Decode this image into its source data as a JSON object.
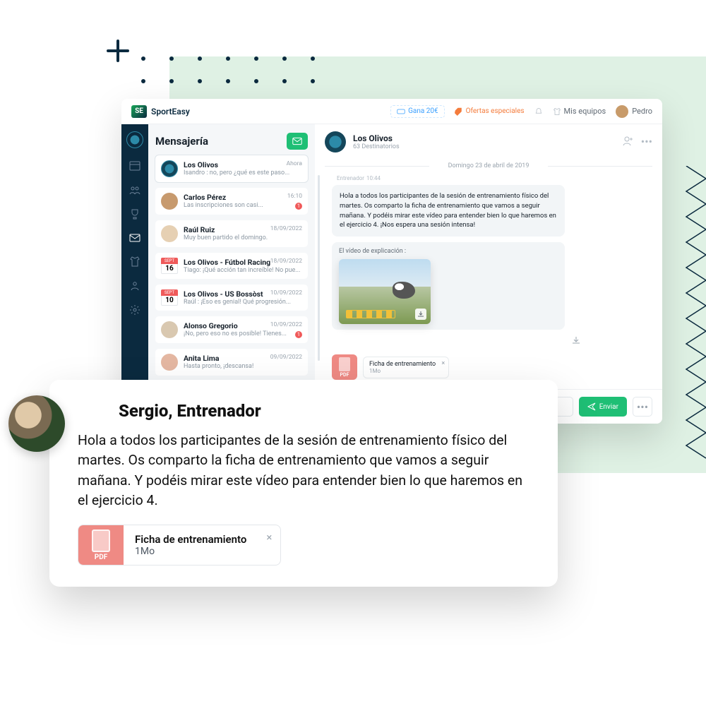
{
  "brand": "SportEasy",
  "topbar": {
    "earn": "Gana 20€",
    "offers": "Ofertas especiales",
    "teams": "Mis equipos",
    "user": "Pedro"
  },
  "sidebar_title": "Mensajería",
  "conversations": [
    {
      "name": "Los Olivos",
      "preview": "Isandro : no, pero ¿qué es este paso...",
      "time": "Ahora"
    },
    {
      "name": "Carlos Pérez",
      "preview": "Las inscripciones son casi...",
      "time": "16:10",
      "badge": "1"
    },
    {
      "name": "Raúl Ruiz",
      "preview": "Muy buen partido el domingo.",
      "time": "18/09/2022"
    },
    {
      "name": "Los Olivos - Fútbol Racing",
      "preview": "Tiago: ¡Qué acción tan increíble! No pue...",
      "time": "18/09/2022",
      "month": "SEPT",
      "day": "16"
    },
    {
      "name": "Los Olivos - US Bossòst",
      "preview": "Raúl : ¡Eso es genial! Qué progresión...",
      "time": "10/09/2022",
      "month": "SEPT",
      "day": "10"
    },
    {
      "name": "Alonso Gregorio",
      "preview": "¡No, pero eso no es posible! Tienes...",
      "time": "10/09/2022",
      "badge": "1"
    },
    {
      "name": "Anita Lima",
      "preview": "Hasta pronto, ¡descansa!",
      "time": "09/09/2022"
    }
  ],
  "chat": {
    "title": "Los Olivos",
    "subtitle": "63 Destinatorios",
    "date": "Domingo 23 de abril de 2019",
    "sender": "Entrenador",
    "sender_time": "10:44",
    "message": "Hola a todos los participantes de la sesión de entrenamiento físico del martes. Os comparto la ficha de entrenamiento que vamos a seguir mañana. Y podéis mirar este vídeo para entender bien lo que haremos en el ejercicio 4. ¡Nos espera una sesión intensa!",
    "media_label": "El vídeo de explicación :",
    "attachment": {
      "name": "Ficha de entrenamiento",
      "size": "1Mo",
      "type": "PDF"
    },
    "send": "Enviar"
  },
  "overlay": {
    "title": "Sergio, Entrenador",
    "body": "Hola a todos los participantes de la sesión de entrenamiento físico del martes. Os comparto la ficha de entrenamiento que vamos a seguir mañana. Y podéis mirar este vídeo para entender bien lo que haremos en el ejercicio 4.",
    "attachment": {
      "name": "Ficha de entrenamiento",
      "size": "1Mo",
      "type": "PDF"
    }
  }
}
